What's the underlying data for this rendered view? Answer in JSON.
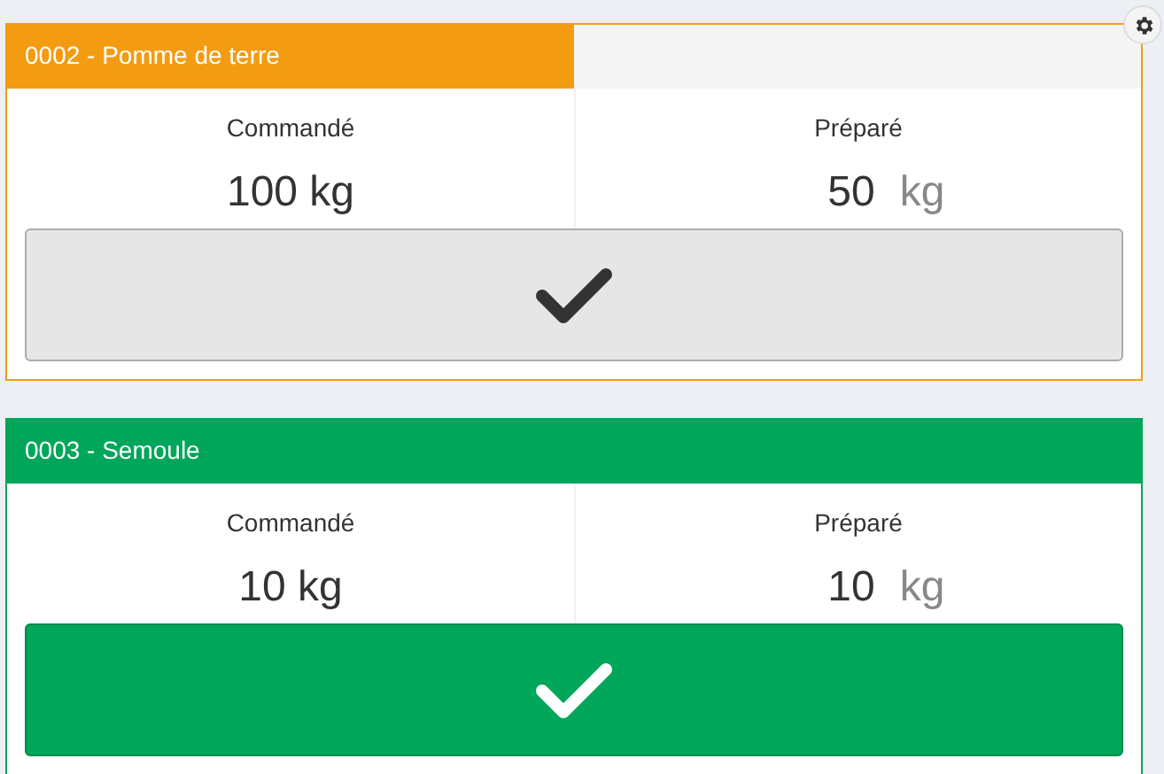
{
  "orders": [
    {
      "title": "0002 - Pomme de terre",
      "level": 0.5,
      "complete": false,
      "ordered_label": "Commandé",
      "ordered": "100 kg",
      "prepared_label": "Préparé",
      "prepared": "50",
      "unit": "kg"
    },
    {
      "title": "0003 - Semoule",
      "level": 1,
      "complete": true,
      "ordered_label": "Commandé",
      "ordered": "10 kg",
      "prepared_label": "Préparé",
      "prepared": "10",
      "unit": "kg"
    }
  ]
}
